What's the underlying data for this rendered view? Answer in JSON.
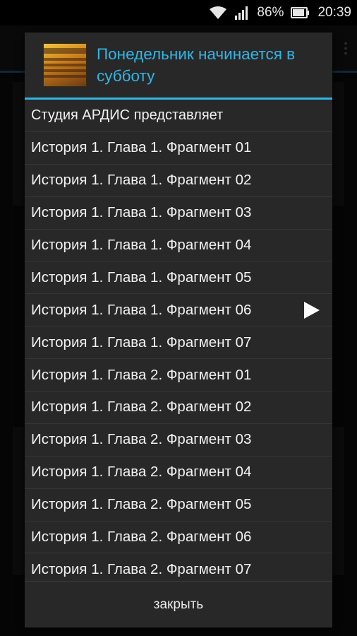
{
  "statusbar": {
    "battery_percent": "86%",
    "time": "20:39",
    "icons": [
      "wifi-icon",
      "signal-icon",
      "battery-icon"
    ]
  },
  "dialog": {
    "title": "Понедельник начинается в субботу",
    "cover_icon": "book-cover-icon",
    "items": [
      {
        "label": "Студия АРДИС представляет",
        "playing": false
      },
      {
        "label": "История 1. Глава 1. Фрагмент 01",
        "playing": false
      },
      {
        "label": "История 1. Глава 1. Фрагмент 02",
        "playing": false
      },
      {
        "label": "История 1. Глава 1. Фрагмент 03",
        "playing": false
      },
      {
        "label": "История 1. Глава 1. Фрагмент 04",
        "playing": false
      },
      {
        "label": "История 1. Глава 1. Фрагмент 05",
        "playing": false
      },
      {
        "label": "История 1. Глава 1. Фрагмент 06",
        "playing": true
      },
      {
        "label": "История 1. Глава 1. Фрагмент 07",
        "playing": false
      },
      {
        "label": "История 1. Глава 2. Фрагмент 01",
        "playing": false
      },
      {
        "label": "История 1. Глава 2. Фрагмент 02",
        "playing": false
      },
      {
        "label": "История 1. Глава 2. Фрагмент 03",
        "playing": false
      },
      {
        "label": "История 1. Глава 2. Фрагмент 04",
        "playing": false
      },
      {
        "label": "История 1. Глава 2. Фрагмент 05",
        "playing": false
      },
      {
        "label": "История 1. Глава 2. Фрагмент 06",
        "playing": false
      },
      {
        "label": "История 1. Глава 2. Фрагмент 07",
        "playing": false
      }
    ],
    "close_label": "закрыть"
  },
  "colors": {
    "accent": "#33b5e5",
    "dialog_bg": "#282828"
  }
}
